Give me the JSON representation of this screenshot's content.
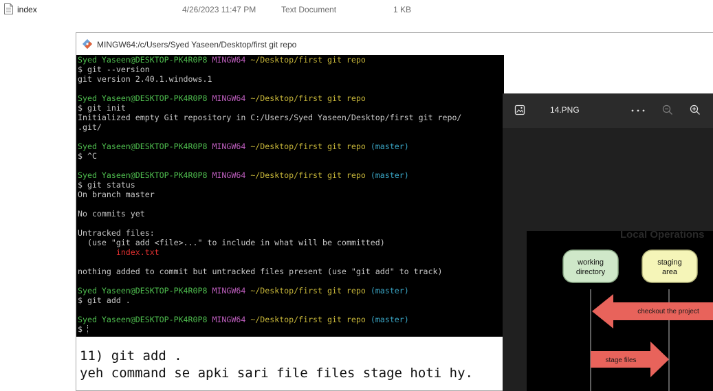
{
  "explorer": {
    "file": {
      "name": "index",
      "date": "4/26/2023 11:47 PM",
      "type": "Text Document",
      "size": "1 KB"
    }
  },
  "terminal": {
    "title": "MINGW64:/c/Users/Syed Yaseen/Desktop/first git repo",
    "prompt": {
      "user": "Syed Yaseen@DESKTOP-PK4R0P8",
      "shell": "MINGW64",
      "path": "~/Desktop/first git repo",
      "branch": "(master)"
    },
    "lines": {
      "cmd1": "$ git --version",
      "out1": "git version 2.40.1.windows.1",
      "cmd2": "$ git init",
      "out2a": "Initialized empty Git repository in C:/Users/Syed Yaseen/Desktop/first git repo/",
      "out2b": ".git/",
      "cmd3": "$ ^C",
      "cmd4": "$ git status",
      "out4a": "On branch master",
      "out4b": "No commits yet",
      "out4c": "Untracked files:",
      "out4d": "  (use \"git add <file>...\" to include in what will be committed)",
      "out4e": "        index.txt",
      "out4f": "nothing added to commit but untracked files present (use \"git add\" to track)",
      "cmd5": "$ git add .",
      "cmd6": "$ "
    }
  },
  "note": {
    "line1": "11) git add .",
    "line2": "yeh command se apki sari file files stage hoti hy."
  },
  "viewer": {
    "filename": "14.PNG",
    "icons": [
      "image-icon",
      "more-icon",
      "zoom-out-icon",
      "zoom-in-icon"
    ],
    "diagram": {
      "heading": "Local Operations",
      "box1": "working\ndirectory",
      "box2": "staging\narea",
      "arrow1": "checkout the project",
      "arrow2": "stage files"
    }
  }
}
